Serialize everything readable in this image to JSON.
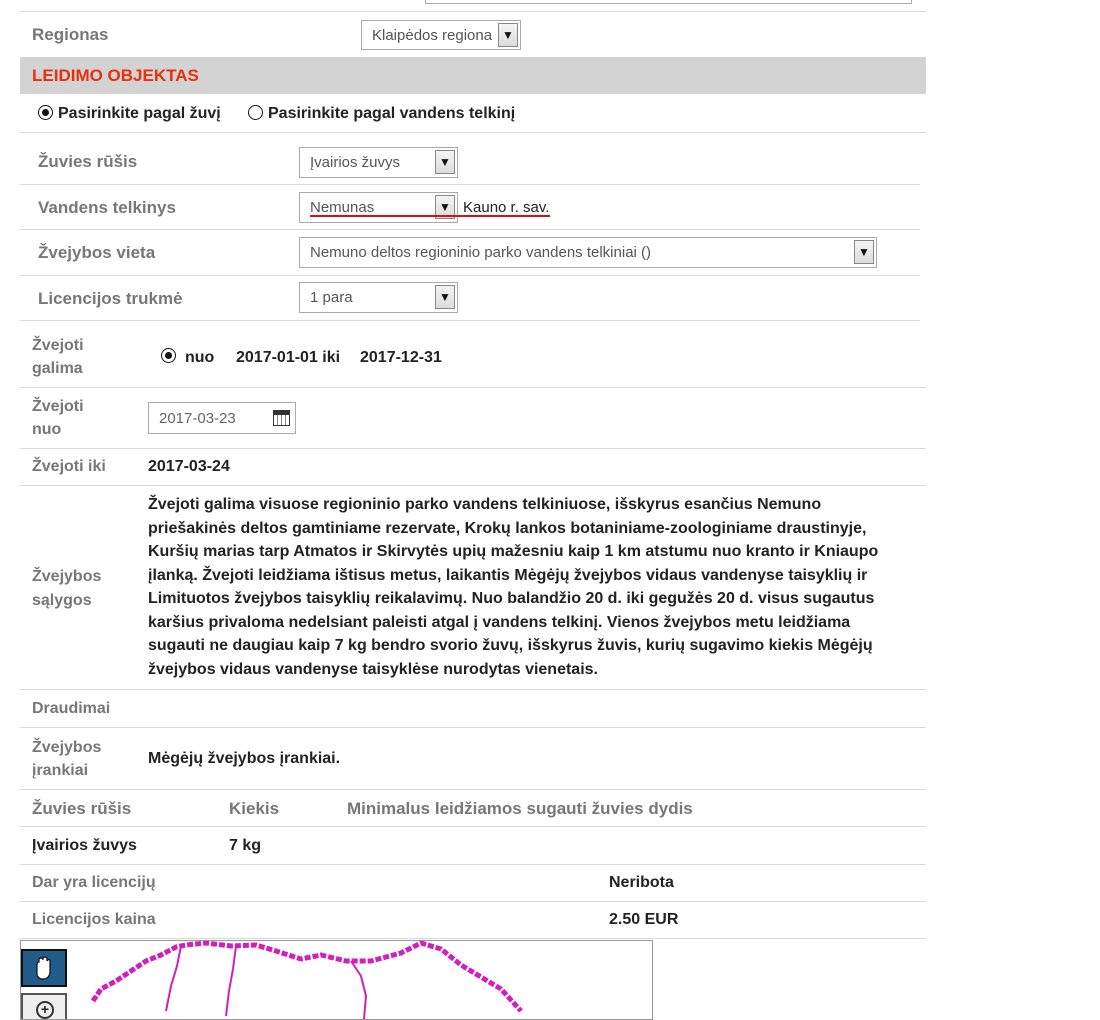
{
  "region": {
    "label": "Regionas",
    "value": "Klaipėdos regiona"
  },
  "section": {
    "title": "LEIDIMO OBJEKTAS"
  },
  "mode": {
    "by_fish": "Pasirinkite pagal žuvį",
    "by_water": "Pasirinkite pagal vandens telkinį",
    "selected": "by_fish"
  },
  "fields": {
    "fish_species": {
      "label": "Žuvies rūšis",
      "value": "Įvairios žuvys"
    },
    "water_body": {
      "label": "Vandens telkinys",
      "value": "Nemunas",
      "note": "Kauno r. sav."
    },
    "fishing_place": {
      "label": "Žvejybos vieta",
      "value": "Nemuno deltos regioninio parko vandens telkiniai ()"
    },
    "license_duration": {
      "label": "Licencijos trukmė",
      "value": "1 para"
    }
  },
  "allowed": {
    "label_line1": "Žvejoti",
    "label_line2": "galima",
    "option": "nuo",
    "from": "2017-01-01 iki",
    "to": "2017-12-31"
  },
  "from_date": {
    "label_line1": "Žvejoti",
    "label_line2": "nuo",
    "value": "2017-03-23"
  },
  "until": {
    "label": "Žvejoti iki",
    "value": "2017-03-24"
  },
  "conditions": {
    "label_line1": "Žvejybos",
    "label_line2": "sąlygos",
    "text": "Žvejoti galima visuose regioninio parko vandens telkiniuose, išskyrus esančius Nemuno priešakinės deltos gamtiniame rezervate, Krokų lankos botaniniame-zoologiniame draustinyje, Kuršių marias tarp Atmatos ir Skirvytės upių mažesniu kaip 1 km atstumu nuo kranto ir Kniaupo įlanką. Žvejoti leidžiama ištisus metus, laikantis Mėgėjų žvejybos vidaus vandenyse taisyklių ir Limituotos žvejybos taisyklių reikalavimų. Nuo balandžio 20 d. iki gegužės 20 d. visus sugautus karšius privaloma nedelsiant paleisti atgal į vandens telkinį. Vienos žvejybos metu leidžiama sugauti ne daugiau kaip 7 kg bendro svorio žuvų, išskyrus žuvis, kurių sugavimo kiekis Mėgėjų žvejybos vidaus vandenyse taisyklėse nurodytas vienetais."
  },
  "prohibitions": {
    "label": "Draudimai"
  },
  "tools": {
    "label_line1": "Žvejybos",
    "label_line2": "įrankiai",
    "value": "Mėgėjų žvejybos įrankiai."
  },
  "catch_table": {
    "headers": [
      "Žuvies rūšis",
      "Kiekis",
      "Minimalus leidžiamos sugauti žuvies dydis"
    ],
    "rows": [
      {
        "species": "Įvairios žuvys",
        "amount": "7 kg",
        "min_size": ""
      }
    ]
  },
  "licenses_left": {
    "label": "Dar yra licencijų",
    "value": "Neribota"
  },
  "price": {
    "label": "Licencijos kaina",
    "value": "2.50 EUR"
  },
  "map": {
    "tools": [
      "hand-pan-icon",
      "zoom-in-icon"
    ],
    "boundary_color": "#d21fb9"
  }
}
